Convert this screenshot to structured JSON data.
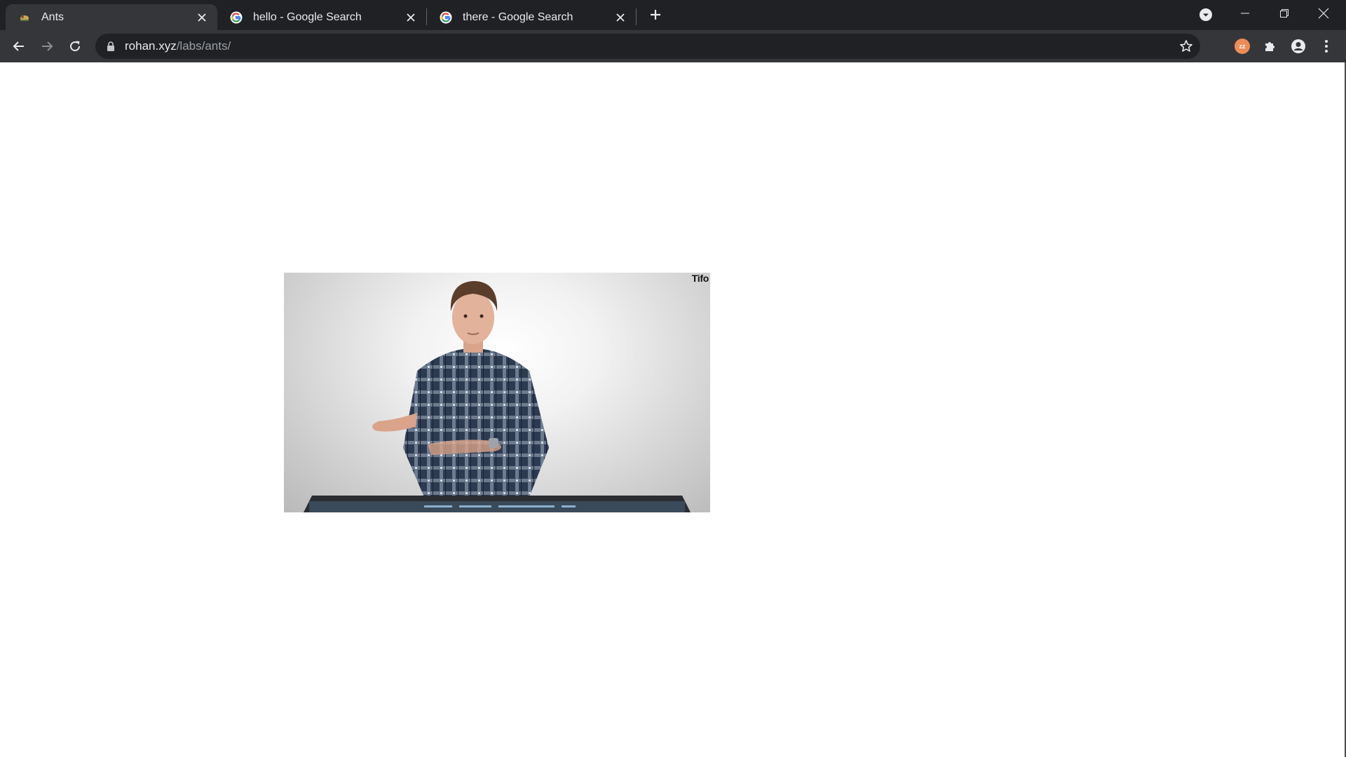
{
  "browser": {
    "tabs": [
      {
        "title": "Ants",
        "active": true,
        "favicon": "ant-favicon"
      },
      {
        "title": "hello - Google Search",
        "active": false,
        "favicon": "google-g-favicon"
      },
      {
        "title": "there - Google Search",
        "active": false,
        "favicon": "google-g-favicon"
      }
    ],
    "address_bar": {
      "domain": "rohan.xyz",
      "path": "/labs/ants/"
    },
    "extension_badge": "zz"
  },
  "page": {
    "video": {
      "brand": "Tifo"
    }
  },
  "colors": {
    "tabstrip_bg": "#202124",
    "toolbar_bg": "#35363a",
    "omnibox_bg": "#202124",
    "page_bg": "#ffffff"
  }
}
